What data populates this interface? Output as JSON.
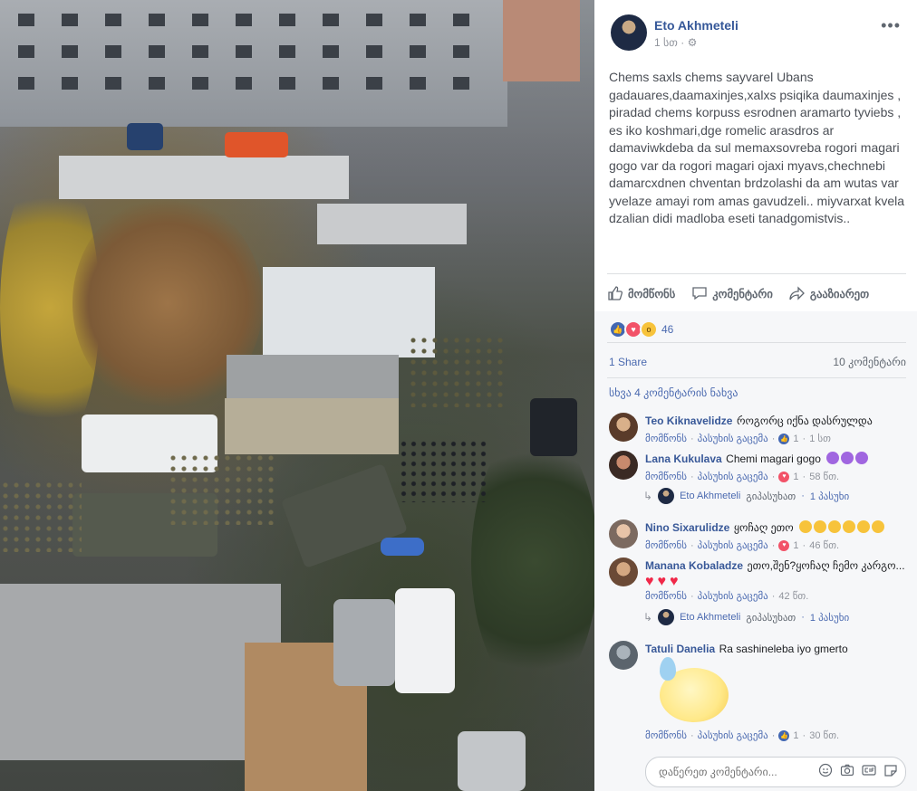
{
  "post": {
    "author": "Eto Akhmeteli",
    "time": "1 სთ",
    "more": "•••",
    "text": "Chems saxls chems sayvarel Ubans gadauares,daamaxinjes,xalxs psiqika daumaxinjes , piradad chems korpuss esrodnen aramarto tyviebs , es iko koshmari,dge romelic arasdros ar damaviwkdeba da sul memaxsovreba rogori magari gogo var da rogori magari ojaxi myavs,chechnebi damarcxdnen chventan brdzolashi da am wutas var yvelaze amayi rom amas gavudzeli.. miyvarxat kvela dzalian didi madloba eseti tanadgomistvis.."
  },
  "actions": {
    "like": "მომწონს",
    "comment": "კომენტარი",
    "share": "გააზიარეთ"
  },
  "stats": {
    "reaction_count": "46",
    "shares": "1 Share",
    "comments": "10 კომენტარი",
    "view_more": "სხვა 4 კომენტარის ნახვა"
  },
  "comments": [
    {
      "name": "Teo Kiknavelidze",
      "text": "როგორც იქნა დასრულდა",
      "like": "მომწონს",
      "reply": "პასუხის გაცემა",
      "count": "1",
      "time": "1 სთ",
      "reaction": "like"
    },
    {
      "name": "Lana Kukulava",
      "text": "Chemi magari gogo",
      "like": "მომწონს",
      "reply": "პასუხის გაცემა",
      "count": "1",
      "time": "58 წთ.",
      "reaction": "love",
      "reply_by": "Eto Akhmeteli",
      "reply_verb": "გიპასუხათ",
      "reply_count": "1 პასუხი"
    },
    {
      "name": "Nino Sixarulidze",
      "text": "ყოჩაღ ეთო",
      "like": "მომწონს",
      "reply": "პასუხის გაცემა",
      "count": "1",
      "time": "46 წთ.",
      "reaction": "love"
    },
    {
      "name": "Manana Kobaladze",
      "text": "ეთო,შენ?ყოჩაღ ჩემო კარგო...",
      "like": "მომწონს",
      "reply": "პასუხის გაცემა",
      "time": "42 წთ.",
      "reply_by": "Eto Akhmeteli",
      "reply_verb": "გიპასუხათ",
      "reply_count": "1 პასუხი"
    },
    {
      "name": "Tatuli Danelia",
      "text": "Ra sashineleba iyo gmerto",
      "like": "მომწონს",
      "reply": "პასუხის გაცემა",
      "count": "1",
      "time": "30 წთ.",
      "reaction": "like"
    }
  ],
  "composer": {
    "placeholder": "დაწერეთ კომენტარი..."
  },
  "colors": {
    "link": "#365899",
    "like_blue": "#4267b2",
    "love_red": "#f25268"
  }
}
